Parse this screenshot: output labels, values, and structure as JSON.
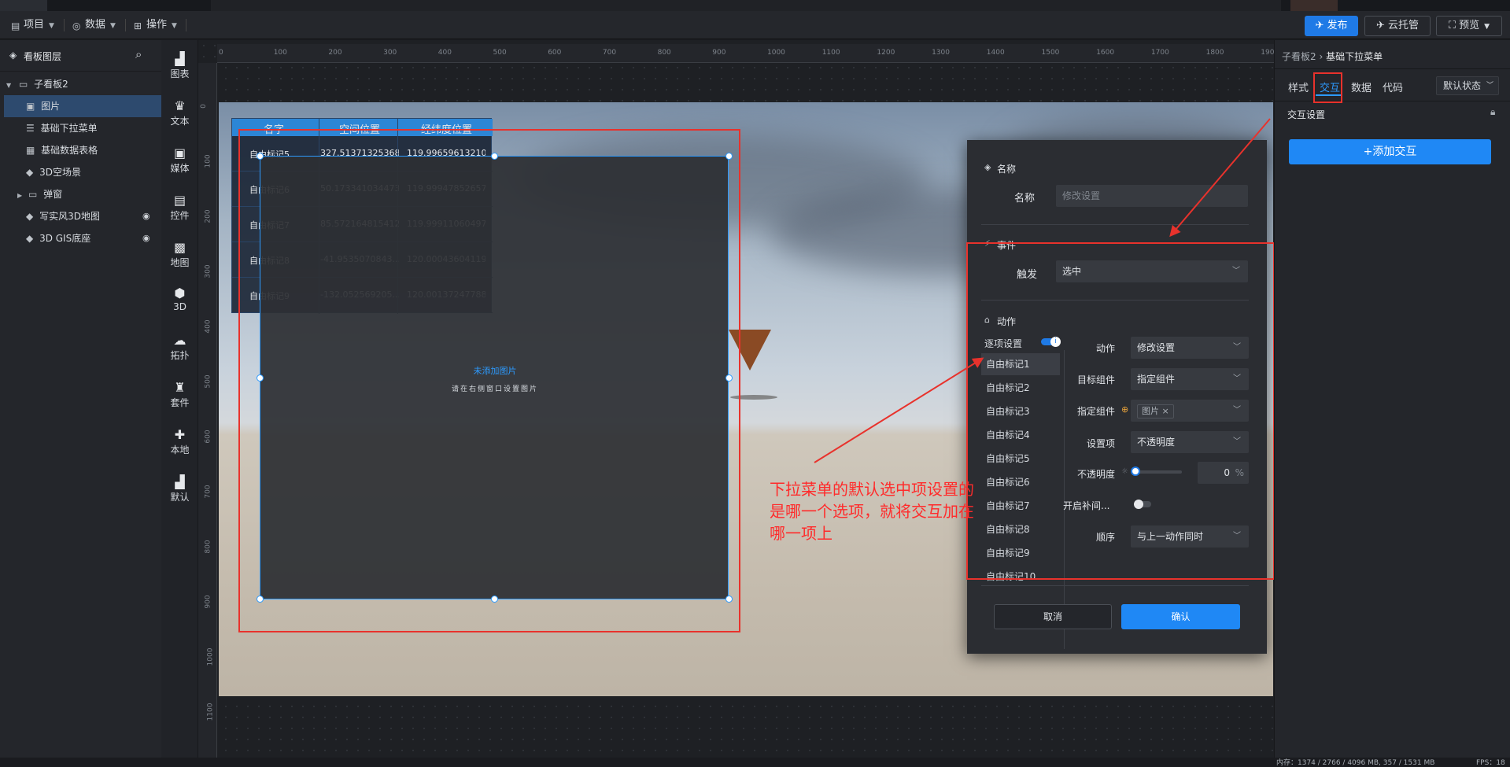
{
  "topbar": {
    "menus": [
      {
        "label": "项目",
        "icon": "file-icon"
      },
      {
        "label": "数据",
        "icon": "database-icon"
      },
      {
        "label": "操作",
        "icon": "grid-icon"
      }
    ],
    "publish_label": "发布",
    "cloud_label": "云托管",
    "preview_label": "预览"
  },
  "layers": {
    "title": "看板图层",
    "items": [
      {
        "label": "子看板2"
      },
      {
        "label": "图片"
      },
      {
        "label": "基础下拉菜单"
      },
      {
        "label": "基础数据表格"
      },
      {
        "label": "3D空场景"
      },
      {
        "label": "弹窗"
      },
      {
        "label": "写实风3D地图"
      },
      {
        "label": "3D GIS底座"
      }
    ]
  },
  "component_bar": [
    "图表",
    "文本",
    "媒体",
    "控件",
    "地图",
    "3D",
    "拓扑",
    "套件",
    "本地",
    "默认"
  ],
  "ruler": {
    "h_ticks": [
      "0",
      "100",
      "200",
      "300",
      "400",
      "500",
      "600",
      "700",
      "800",
      "900",
      "1000",
      "1100",
      "1200",
      "1300",
      "1400",
      "1500",
      "1600",
      "1700",
      "1800",
      "1900"
    ],
    "v_ticks": [
      "0",
      "100",
      "200",
      "300",
      "400",
      "500",
      "600",
      "700",
      "800",
      "900",
      "1000",
      "1100"
    ]
  },
  "table": {
    "headers": [
      "名字",
      "空间位置",
      "经纬度位置"
    ],
    "rows": [
      [
        "自由标记5",
        "327.51371325368",
        "119.99659613210"
      ],
      [
        "自由标记6",
        "50.173341034473...",
        "119.99947852657..."
      ],
      [
        "自由标记7",
        "85.572164815412...",
        "119.99911060497..."
      ],
      [
        "自由标记8",
        "-41.9535070843...",
        "120.00043604119..."
      ],
      [
        "自由标记9",
        "-132.052569205...",
        "120.00137247788..."
      ]
    ]
  },
  "image_placeholder": {
    "title": "未添加图片",
    "hint": "请在右侧窗口设置图片"
  },
  "dialog": {
    "name_section": "名称",
    "name_label": "名称",
    "name_placeholder": "修改设置",
    "event_section": "事件",
    "trigger_label": "触发",
    "trigger_value": "选中",
    "action_section": "动作",
    "per_item_label": "逐项设置",
    "list": [
      "自由标记1",
      "自由标记2",
      "自由标记3",
      "自由标记4",
      "自由标记5",
      "自由标记6",
      "自由标记7",
      "自由标记8",
      "自由标记9",
      "自由标记10"
    ],
    "action_label": "动作",
    "action_value": "修改设置",
    "target_label": "目标组件",
    "target_value": "指定组件",
    "specify_label": "指定组件",
    "specify_tag": "图片",
    "setting_label": "设置项",
    "setting_value": "不透明度",
    "opacity_label": "不透明度",
    "opacity_value": "0",
    "opacity_unit": "%",
    "tween_label": "开启补间...",
    "order_label": "顺序",
    "order_value": "与上一动作同时",
    "cancel_label": "取消",
    "confirm_label": "确认"
  },
  "annotation": "下拉菜单的默认选中项设置的是哪一个选项，就将交互加在哪一项上",
  "right_panel": {
    "breadcrumb_parent": "子看板2",
    "breadcrumb_sep": "›",
    "breadcrumb_current": "基础下拉菜单",
    "tabs": [
      "样式",
      "交互",
      "数据",
      "代码"
    ],
    "state_select": "默认状态",
    "section_title": "交互设置",
    "add_button": "+添加交互"
  },
  "statusbar": {
    "memory": "内存：1374 / 2766 / 4096 MB, 357 / 1531 MB",
    "fps": "FPS：18"
  },
  "colors": {
    "accent": "#1f7ae6",
    "selection": "#2d9bff",
    "annotation_red": "#e8322c",
    "table_header": "#2c86d6"
  }
}
